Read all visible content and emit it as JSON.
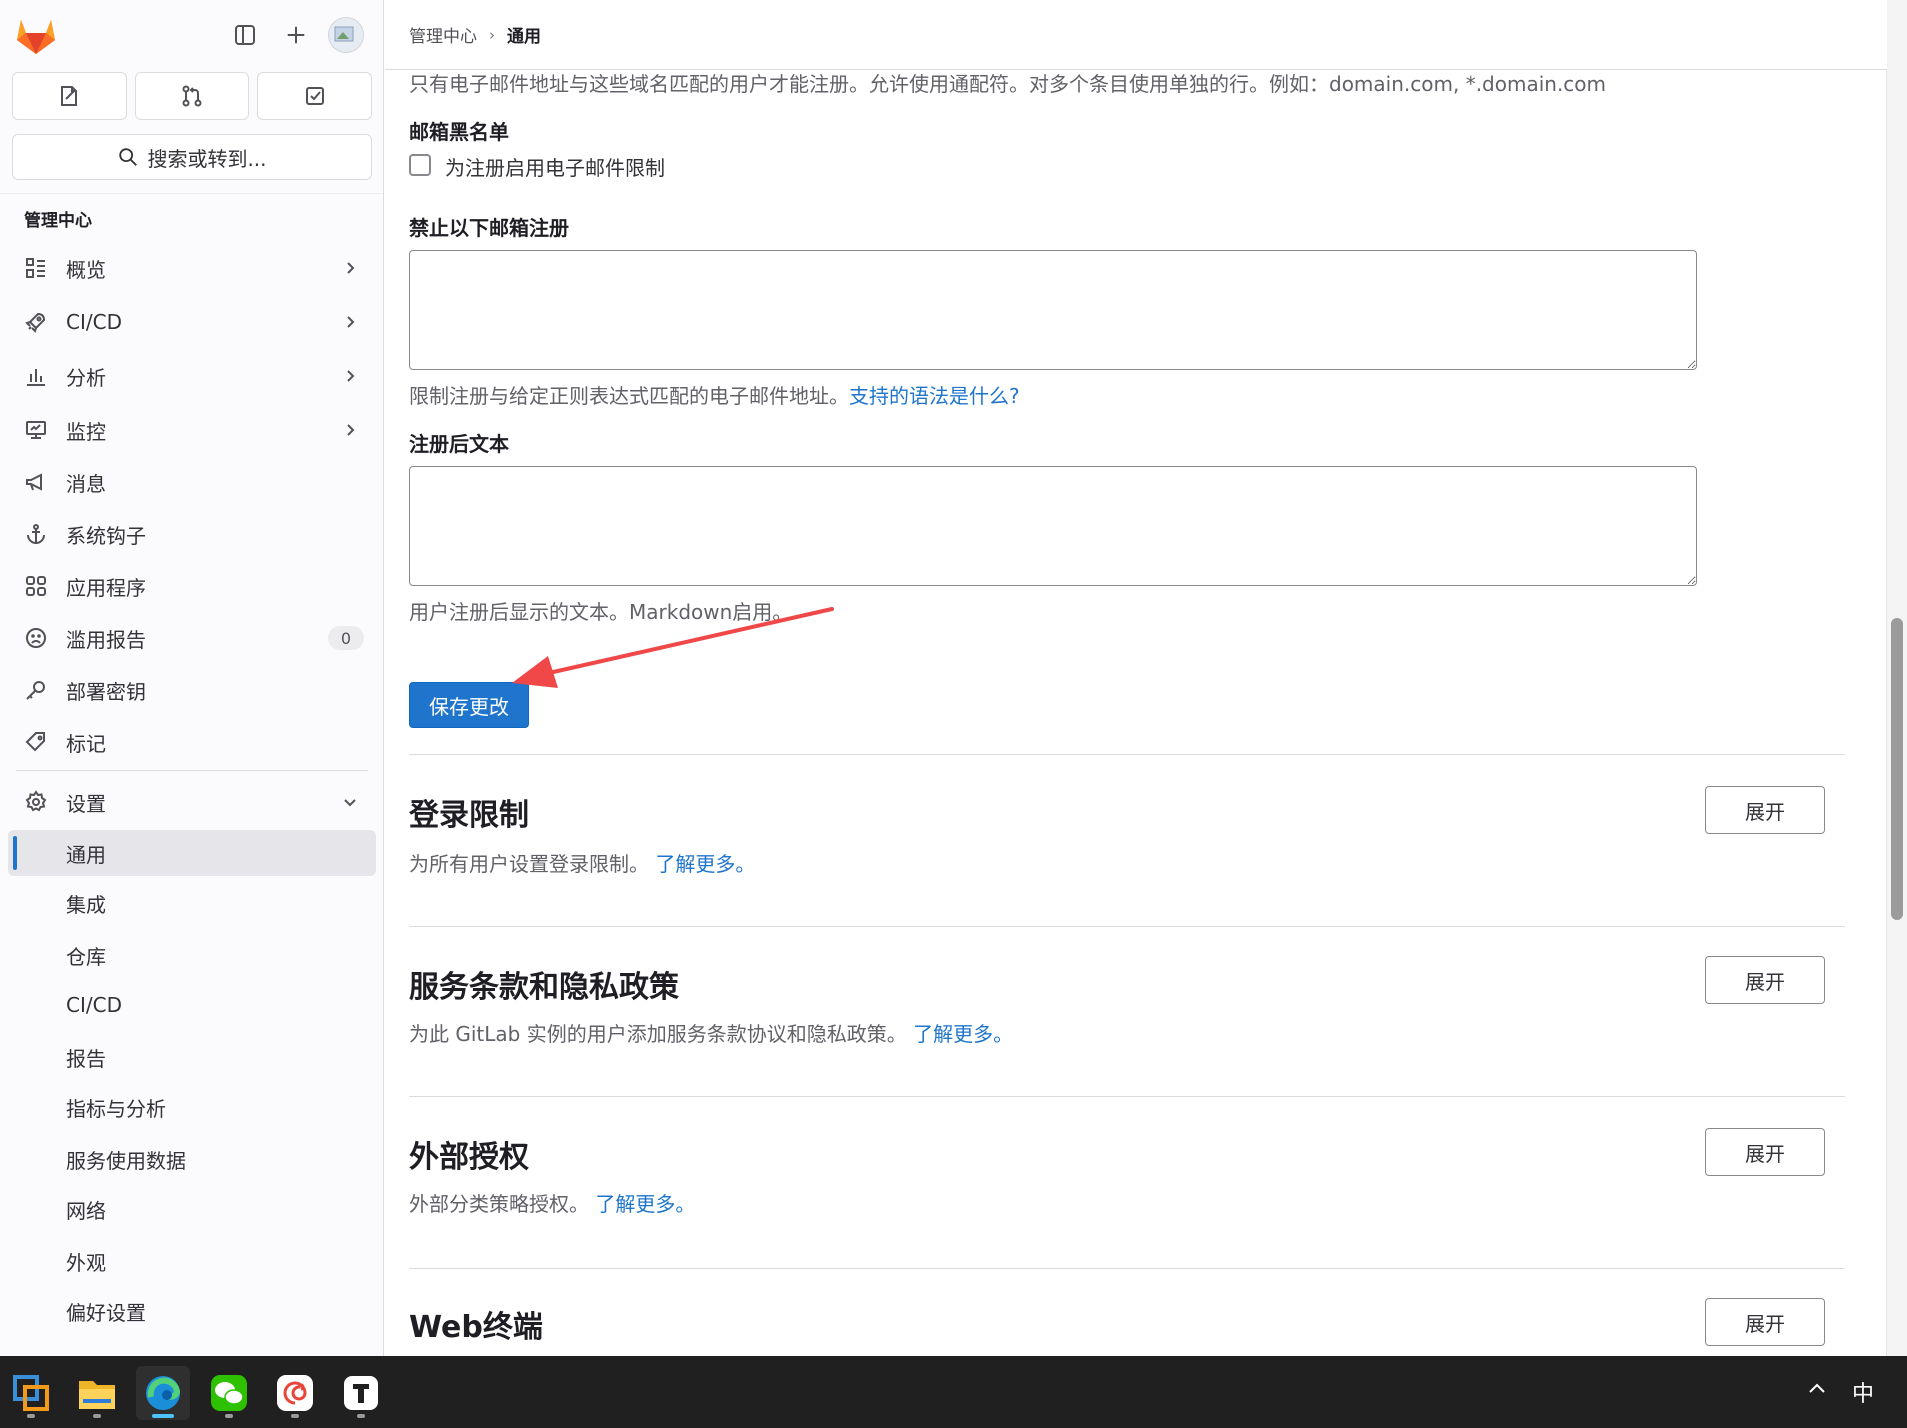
{
  "sidebar": {
    "search_label": "搜索或转到...",
    "section_title": "管理中心",
    "nav": [
      {
        "label": "概览",
        "icon": "overview-icon"
      },
      {
        "label": "CI/CD",
        "icon": "rocket-icon"
      },
      {
        "label": "分析",
        "icon": "chart-icon"
      },
      {
        "label": "监控",
        "icon": "monitor-icon"
      },
      {
        "label": "消息",
        "icon": "bullhorn-icon"
      },
      {
        "label": "系统钩子",
        "icon": "anchor-icon"
      },
      {
        "label": "应用程序",
        "icon": "apps-icon"
      },
      {
        "label": "滥用报告",
        "icon": "sad-face-icon",
        "badge": "0"
      },
      {
        "label": "部署密钥",
        "icon": "key-icon"
      },
      {
        "label": "标记",
        "icon": "label-icon"
      }
    ],
    "settings_label": "设置",
    "settings_sub": [
      "通用",
      "集成",
      "仓库",
      "CI/CD",
      "报告",
      "指标与分析",
      "服务使用数据",
      "网络",
      "外观",
      "偏好设置"
    ]
  },
  "breadcrumb": {
    "parent": "管理中心",
    "current": "通用"
  },
  "form": {
    "allowlist_help": "只有电子邮件地址与这些域名匹配的用户才能注册。允许使用通配符。对多个条目使用单独的行。例如：domain.com, *.domain.com",
    "denylist_label": "邮箱黑名单",
    "denylist_checkbox": "为注册启用电子邮件限制",
    "restrict_label": "禁止以下邮箱注册",
    "restrict_help": "限制注册与给定正则表达式匹配的电子邮件地址。",
    "restrict_link": "支持的语法是什么?",
    "after_signup_label": "注册后文本",
    "after_signup_help": "用户注册后显示的文本。Markdown启用。",
    "save_label": "保存更改"
  },
  "sections": [
    {
      "title": "登录限制",
      "desc": "为所有用户设置登录限制。",
      "link": "了解更多。",
      "button": "展开"
    },
    {
      "title": "服务条款和隐私政策",
      "desc": "为此 GitLab 实例的用户添加服务条款协议和隐私政策。",
      "link": "了解更多。",
      "button": "展开"
    },
    {
      "title": "外部授权",
      "desc": "外部分类策略授权。",
      "link": "了解更多。",
      "button": "展开"
    },
    {
      "title": "Web终端",
      "button": "展开"
    }
  ],
  "taskbar": {
    "ime_label": "中",
    "apps": [
      "vmware-icon",
      "file-explorer-icon",
      "edge-browser-icon",
      "wechat-icon",
      "snail-app-icon",
      "typora-icon"
    ]
  },
  "colors": {
    "accent": "#1f75cb",
    "annotation_arrow": "#f04848",
    "gitlab_orange": "#e24329"
  }
}
